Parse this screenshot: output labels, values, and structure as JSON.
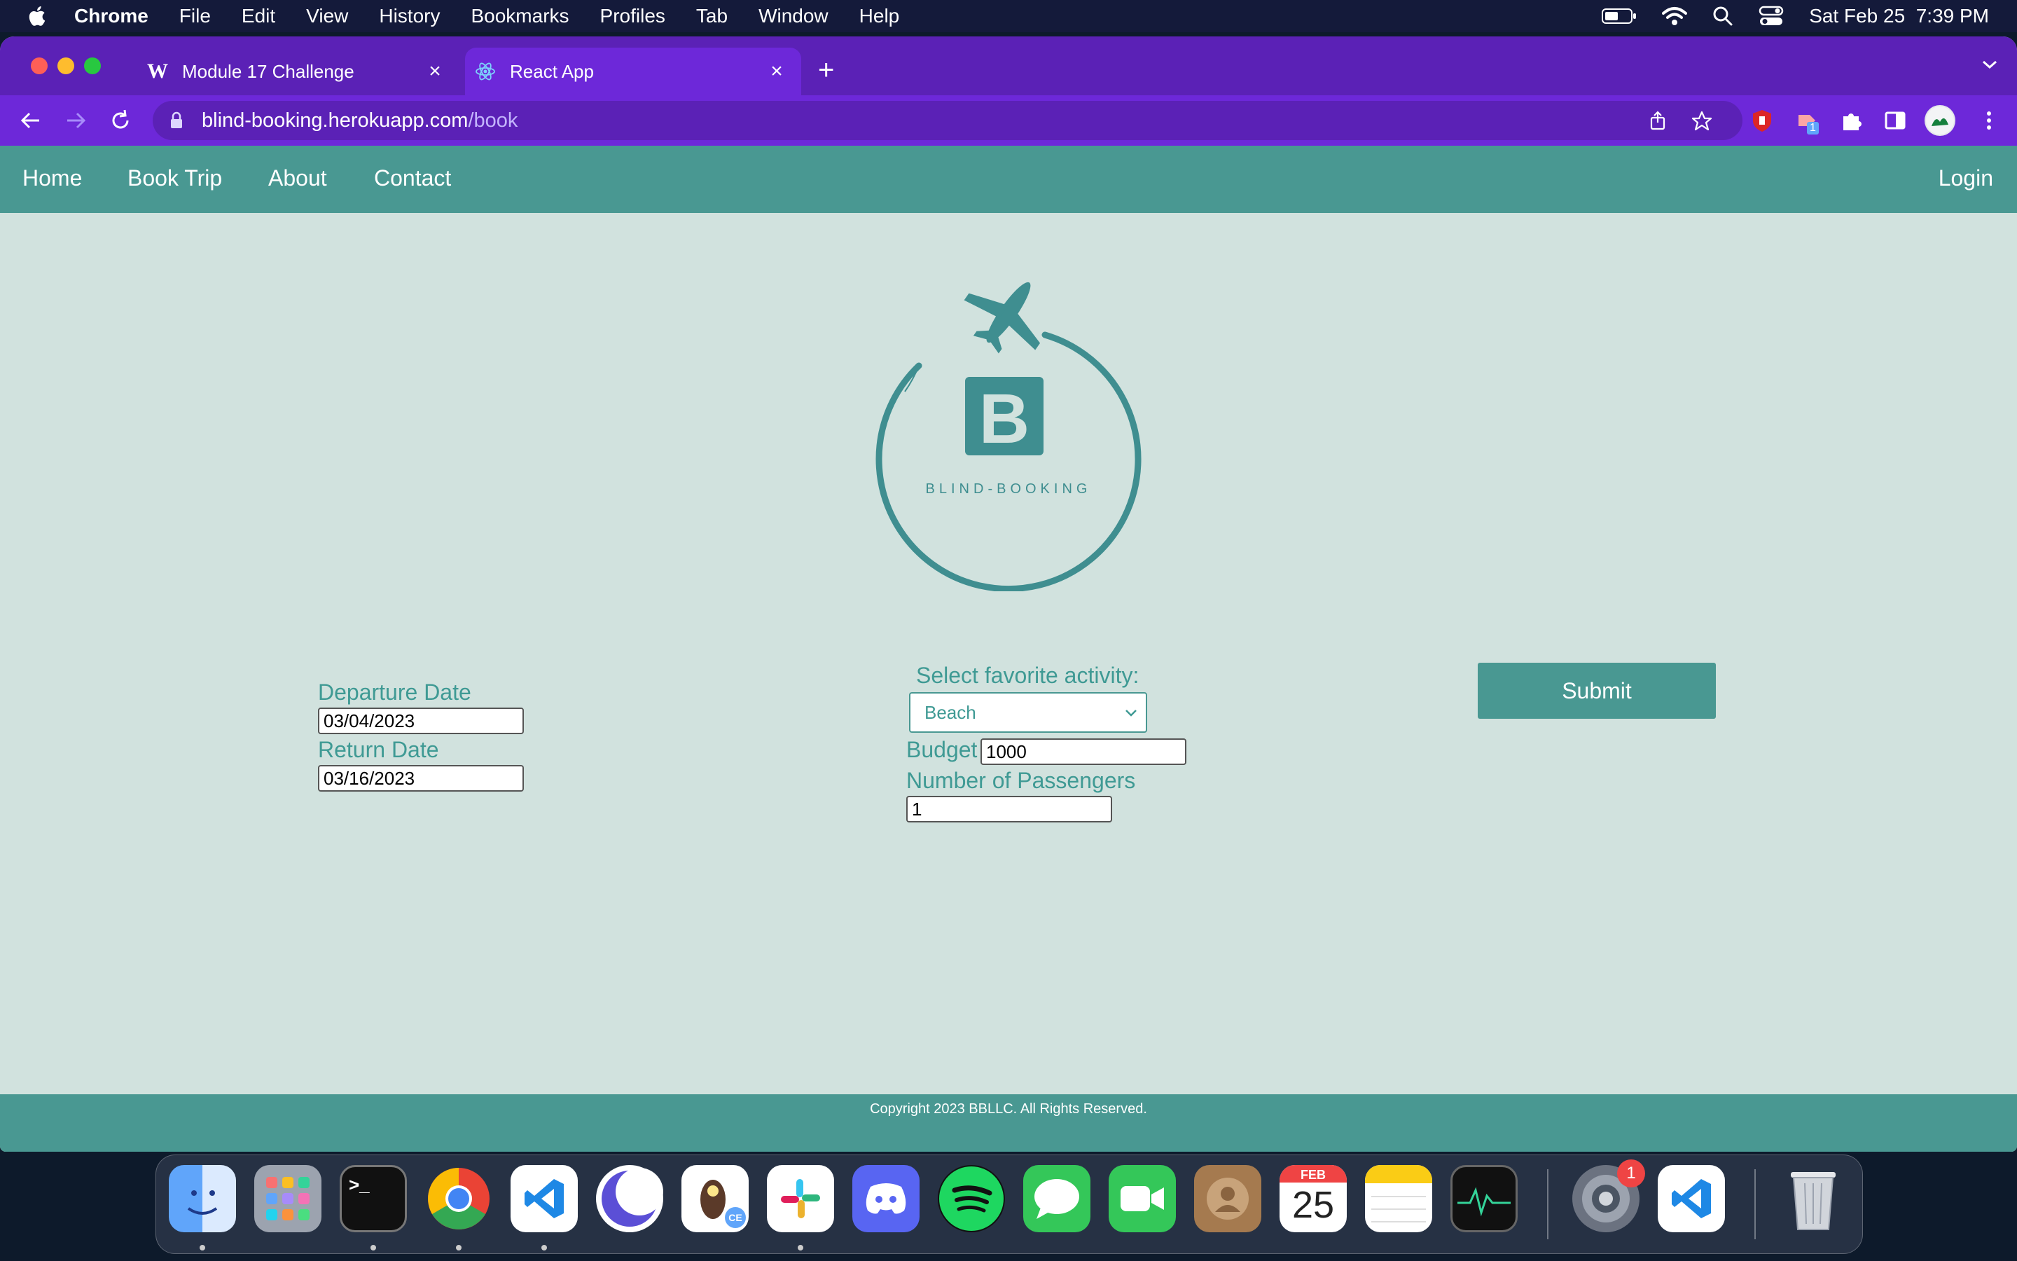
{
  "menubar": {
    "app": "Chrome",
    "items": [
      "File",
      "Edit",
      "View",
      "History",
      "Bookmarks",
      "Profiles",
      "Tab",
      "Window",
      "Help"
    ],
    "datetime": "Sat Feb 25  7:39 PM"
  },
  "browser": {
    "tabs": [
      {
        "title": "Module 17 Challenge",
        "favicon": "W",
        "active": false
      },
      {
        "title": "React App",
        "favicon": "react-icon",
        "active": true
      }
    ],
    "url_host": "blind-booking.herokuapp.com",
    "url_path": "/book",
    "extension_badge": "1"
  },
  "site": {
    "nav": {
      "home": "Home",
      "book_trip": "Book Trip",
      "about": "About",
      "contact": "Contact",
      "login": "Login"
    },
    "logo": {
      "monogram": "B",
      "text": "BLIND-BOOKING"
    },
    "form": {
      "departure_label": "Departure Date",
      "departure_value": "03/04/2023",
      "return_label": "Return Date",
      "return_value": "03/16/2023",
      "activity_label": "Select favorite activity:",
      "activity_value": "Beach",
      "budget_label": "Budget",
      "budget_value": "1000",
      "passengers_label": "Number of Passengers",
      "passengers_value": "1",
      "submit_label": "Submit"
    },
    "footer": "Copyright 2023 BBLLC. All Rights Reserved."
  },
  "dock": {
    "apps": [
      "Finder",
      "Launchpad",
      "Terminal",
      "Chrome",
      "VS Code",
      "Notchmeister",
      "TablePlus",
      "Slack",
      "Discord",
      "Spotify",
      "Messages",
      "FaceTime",
      "Contacts",
      "Calendar",
      "Notes",
      "Activity Monitor",
      "System Settings",
      "VS Code",
      "Trash"
    ],
    "calendar_month": "FEB",
    "calendar_day": "25",
    "settings_badge": "1",
    "terminal_prompt": ">_",
    "tableplus_badge": "CE"
  },
  "colors": {
    "menubar": "#141a3a",
    "tabstrip": "#5b21b6",
    "toolbar": "#6d28d9",
    "site_teal": "#499892",
    "page_bg": "#d1e2de",
    "label_teal": "#3f9a94"
  }
}
